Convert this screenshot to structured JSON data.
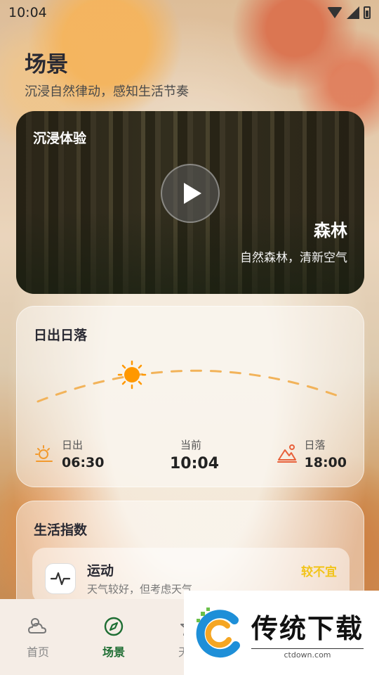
{
  "status_bar": {
    "time": "10:04"
  },
  "header": {
    "title": "场景",
    "subtitle": "沉浸自然律动，感知生活节奏"
  },
  "immersive": {
    "label": "沉浸体验",
    "scene_name": "森林",
    "scene_desc": "自然森林，清新空气"
  },
  "sun": {
    "title": "日出日落",
    "sunrise_label": "日出",
    "sunrise_time": "06:30",
    "now_label": "当前",
    "now_time": "10:04",
    "sunset_label": "日落",
    "sunset_time": "18:00",
    "accent": "#ff9800"
  },
  "life": {
    "title": "生活指数",
    "items": [
      {
        "title": "运动",
        "desc": "天气较好，但考虑天气",
        "level": "较不宜",
        "icon": "pulse-icon"
      }
    ]
  },
  "nav": {
    "items": [
      {
        "label": "首页",
        "icon": "weather-icon"
      },
      {
        "label": "场景",
        "icon": "compass-icon"
      },
      {
        "label": "天文",
        "icon": "star-icon"
      }
    ]
  },
  "watermark": {
    "title": "传统下载",
    "url": "ctdown.com"
  }
}
